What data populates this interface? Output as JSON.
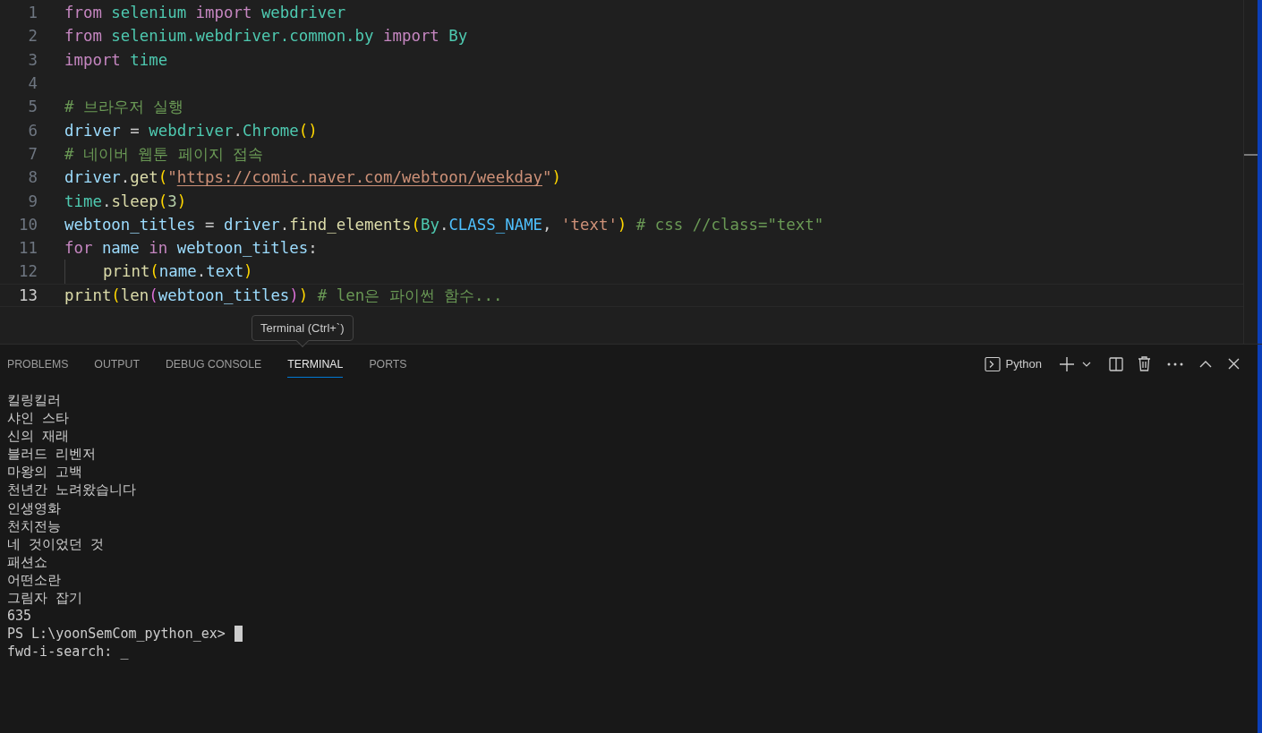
{
  "editor": {
    "lines": [
      {
        "number": "1",
        "current": false,
        "tokens": [
          {
            "text": "from",
            "kind": "keyword"
          },
          {
            "text": " selenium",
            "kind": "module"
          },
          {
            "text": " import",
            "kind": "keyword"
          },
          {
            "text": " webdriver",
            "kind": "module"
          }
        ]
      },
      {
        "number": "2",
        "current": false,
        "tokens": [
          {
            "text": "from",
            "kind": "keyword"
          },
          {
            "text": " selenium.webdriver.common.by",
            "kind": "module"
          },
          {
            "text": " import",
            "kind": "keyword"
          },
          {
            "text": " By",
            "kind": "module"
          }
        ]
      },
      {
        "number": "3",
        "current": false,
        "tokens": [
          {
            "text": "import",
            "kind": "keyword"
          },
          {
            "text": " time",
            "kind": "module"
          }
        ]
      },
      {
        "number": "4",
        "current": false
      },
      {
        "number": "5",
        "current": false,
        "tokens": [
          {
            "text": "# 브라우저 실행",
            "kind": "comment"
          }
        ]
      },
      {
        "number": "6",
        "current": false,
        "tokens": [
          {
            "text": "driver",
            "kind": "variable"
          },
          {
            "text": " = ",
            "kind": "plain"
          },
          {
            "text": "webdriver",
            "kind": "module"
          },
          {
            "text": ".",
            "kind": "plain"
          },
          {
            "text": "Chrome",
            "kind": "module"
          },
          {
            "text": "()",
            "kind": "bracket1"
          }
        ]
      },
      {
        "number": "7",
        "current": false,
        "tokens": [
          {
            "text": "# 네이버 웹툰 페이지 접속",
            "kind": "comment"
          }
        ]
      },
      {
        "number": "8",
        "current": false,
        "tokens": [
          {
            "text": "driver",
            "kind": "variable"
          },
          {
            "text": ".",
            "kind": "plain"
          },
          {
            "text": "get",
            "kind": "function"
          },
          {
            "text": "(",
            "kind": "bracket1"
          },
          {
            "text": "\"",
            "kind": "string"
          },
          {
            "text": "https://comic.naver.com/webtoon/weekday",
            "kind": "link"
          },
          {
            "text": "\"",
            "kind": "string"
          },
          {
            "text": ")",
            "kind": "bracket1"
          }
        ]
      },
      {
        "number": "9",
        "current": false,
        "tokens": [
          {
            "text": "time",
            "kind": "module"
          },
          {
            "text": ".",
            "kind": "plain"
          },
          {
            "text": "sleep",
            "kind": "function"
          },
          {
            "text": "(",
            "kind": "bracket1"
          },
          {
            "text": "3",
            "kind": "number"
          },
          {
            "text": ")",
            "kind": "bracket1"
          }
        ]
      },
      {
        "number": "10",
        "current": false,
        "tokens": [
          {
            "text": "webtoon_titles",
            "kind": "variable"
          },
          {
            "text": " = ",
            "kind": "plain"
          },
          {
            "text": "driver",
            "kind": "variable"
          },
          {
            "text": ".",
            "kind": "plain"
          },
          {
            "text": "find_elements",
            "kind": "function"
          },
          {
            "text": "(",
            "kind": "bracket1"
          },
          {
            "text": "By",
            "kind": "module"
          },
          {
            "text": ".",
            "kind": "plain"
          },
          {
            "text": "CLASS_NAME",
            "kind": "constant"
          },
          {
            "text": ", ",
            "kind": "plain"
          },
          {
            "text": "'text'",
            "kind": "string"
          },
          {
            "text": ")",
            "kind": "bracket1"
          },
          {
            "text": " # css //class=\"text\"",
            "kind": "comment"
          }
        ]
      },
      {
        "number": "11",
        "current": false,
        "tokens": [
          {
            "text": "for",
            "kind": "keyword"
          },
          {
            "text": " name",
            "kind": "variable"
          },
          {
            "text": " in",
            "kind": "keyword"
          },
          {
            "text": " webtoon_titles",
            "kind": "variable"
          },
          {
            "text": ":",
            "kind": "plain"
          }
        ]
      },
      {
        "number": "12",
        "current": false,
        "indented": true,
        "tokens": [
          {
            "text": "print",
            "kind": "function"
          },
          {
            "text": "(",
            "kind": "bracket1"
          },
          {
            "text": "name",
            "kind": "variable"
          },
          {
            "text": ".",
            "kind": "plain"
          },
          {
            "text": "text",
            "kind": "variable"
          },
          {
            "text": ")",
            "kind": "bracket1"
          }
        ]
      },
      {
        "number": "13",
        "current": true,
        "tokens": [
          {
            "text": "print",
            "kind": "function"
          },
          {
            "text": "(",
            "kind": "bracket1"
          },
          {
            "text": "len",
            "kind": "function"
          },
          {
            "text": "(",
            "kind": "bracket2"
          },
          {
            "text": "webtoon_titles",
            "kind": "variable"
          },
          {
            "text": ")",
            "kind": "bracket2"
          },
          {
            "text": ")",
            "kind": "bracket1"
          },
          {
            "text": " # len은 파이썬 함수...",
            "kind": "comment"
          }
        ]
      }
    ]
  },
  "tooltip": {
    "text": "Terminal (Ctrl+`)"
  },
  "panel": {
    "tabs": [
      {
        "label": "PROBLEMS",
        "selected": false
      },
      {
        "label": "OUTPUT",
        "selected": false
      },
      {
        "label": "DEBUG CONSOLE",
        "selected": false
      },
      {
        "label": "TERMINAL",
        "selected": true
      },
      {
        "label": "PORTS",
        "selected": false
      }
    ],
    "terminal_profile": "Python",
    "terminal": {
      "lines": [
        "킬링킬러",
        "샤인 스타",
        "신의 재래",
        "블러드 리벤저",
        "마왕의 고백",
        "천년간 노려왔습니다",
        "인생영화",
        "천치전능",
        "네 것이었던 것",
        "패션쇼",
        "어떤소란",
        "그림자 잡기",
        "635"
      ],
      "prompt": "PS L:\\yoonSemCom_python_ex>",
      "search_line": "fwd-i-search: _"
    }
  }
}
